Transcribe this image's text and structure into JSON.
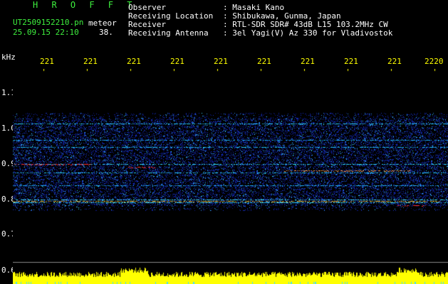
{
  "header": {
    "brand": "H R O F F T",
    "filename": "UT2509152210.pn",
    "mode": "meteor",
    "datetime": "25.09.15 22:10",
    "count": "38.",
    "observer_label": "Observer",
    "observer_value": ": Masaki Kano",
    "location_label": "Receiving Location",
    "location_value": ": Shibukawa, Gunma, Japan",
    "receiver_label": "Receiver",
    "receiver_value": ": RTL-SDR SDR# 43dB L15 103.2MHz CW",
    "antenna_label": "Receiving Antenna",
    "antenna_value": ": 3el Yagi(V) Az 330 for Vladivostok"
  },
  "axis": {
    "y_unit": "kHz",
    "y_ticks": [
      "1.1",
      "1.0",
      "0.9",
      "0.8",
      "0.7",
      "0.6"
    ],
    "x_ticks": [
      "221",
      "221",
      "221",
      "221",
      "221",
      "221",
      "221",
      "221",
      "221",
      "2220"
    ]
  },
  "colors": {
    "text_green": "#3ef03e",
    "tick_yellow": "#ffff00",
    "spectrum_blue": "#1428b4",
    "signal_cyan": "#28c8ff",
    "echo_red": "#ff3030",
    "level_yellow": "#ffff00"
  }
}
